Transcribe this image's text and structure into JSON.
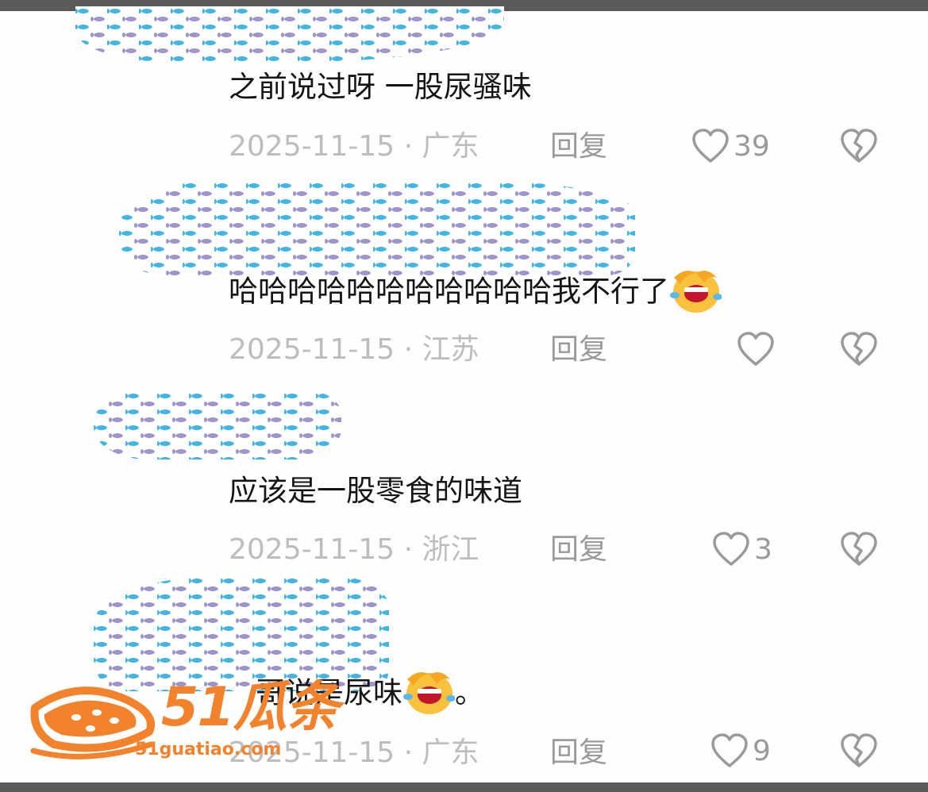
{
  "comments": [
    {
      "text": "之前说过呀 一股尿骚味",
      "date_location": "2025-11-15 · 广东",
      "reply_label": "回复",
      "likes": "39",
      "emoji": null
    },
    {
      "text": "哈哈哈哈哈哈哈哈哈哈哈我不行了",
      "date_location": "2025-11-15 · 江苏",
      "reply_label": "回复",
      "likes": "",
      "emoji": "rolling-on-floor-laughing"
    },
    {
      "text": "应该是一股零食的味道",
      "date_location": "2025-11-15 · 浙江",
      "reply_label": "回复",
      "likes": "3",
      "emoji": null
    },
    {
      "text": "哥说是尿味",
      "text_suffix": "。",
      "date_location": "2025-11-15 · 广东",
      "reply_label": "回复",
      "likes": "9",
      "emoji": "rolling-on-floor-laughing"
    }
  ],
  "icons": {
    "like": "heart-outline-icon",
    "dislike": "broken-heart-icon"
  },
  "colors": {
    "text": "#151515",
    "meta": "#bdbdbd",
    "action": "#9a9a9a",
    "mosaic_blue": "#43b5e2",
    "mosaic_purple": "#a094cc",
    "watermark": "#f3822c"
  },
  "watermark": {
    "brand": "51瓜条",
    "domain": "51guatiao.com"
  }
}
